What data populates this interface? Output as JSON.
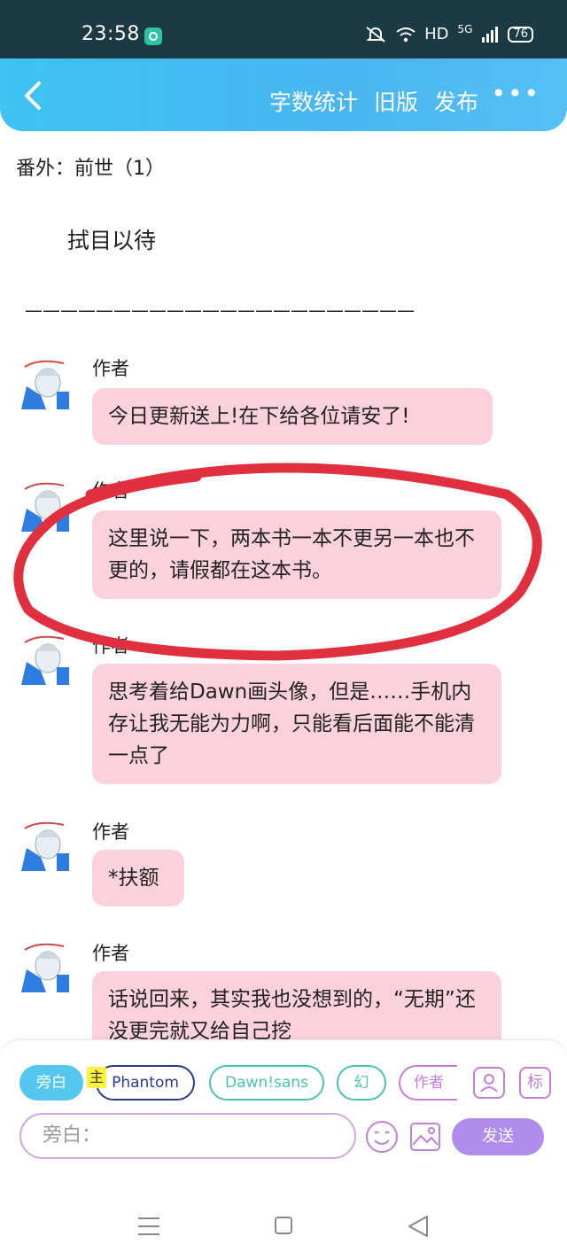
{
  "status": {
    "time": "23:58",
    "hd": "HD",
    "network": "5G",
    "battery": "76"
  },
  "header": {
    "actions": [
      "字数统计",
      "旧版",
      "发布"
    ],
    "more": "•••"
  },
  "content": {
    "chapter_title": "番外：前世（1）",
    "quote": "拭目以待",
    "divider": "——————————————————————"
  },
  "messages": [
    {
      "author": "作者",
      "text": "今日更新送上!在下给各位请安了!"
    },
    {
      "author": "作者",
      "text": "这里说一下，两本书一本不更另一本也不更的，请假都在这本书。"
    },
    {
      "author": "作者",
      "text": "思考着给Dawn画头像，但是……手机内存让我无能为力啊，只能看后面能不能清一点了"
    },
    {
      "author": "作者",
      "text": "*扶额"
    },
    {
      "author": "作者",
      "text": "话说回来，其实我也没想到的，“无期”还没更完就又给自己挖"
    }
  ],
  "tags": {
    "narration": "旁白",
    "main_marker": "主",
    "phantom": "Phantom",
    "dawn": "Dawn!sans",
    "huan": "幻",
    "author": "作者",
    "mark": "标"
  },
  "input": {
    "placeholder": "旁白：",
    "send": "发送"
  },
  "colors": {
    "header": "#3ec3f2",
    "bubble": "#fbd1dc",
    "send": "#b08cec",
    "highlight_circle": "#e0303f"
  }
}
